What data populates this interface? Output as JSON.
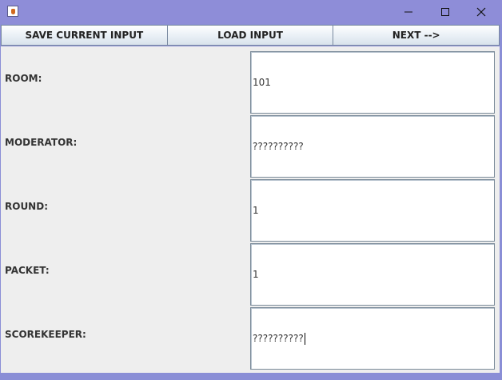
{
  "window": {
    "icon": "java-cup-icon",
    "controls": [
      "minimize-icon",
      "maximize-icon",
      "close-icon"
    ]
  },
  "toolbar": {
    "save_label": "SAVE CURRENT INPUT",
    "load_label": "LOAD INPUT",
    "next_label": "NEXT -->"
  },
  "form": {
    "rows": [
      {
        "label": "ROOM:",
        "value": "101"
      },
      {
        "label": "MODERATOR:",
        "value": "??????????"
      },
      {
        "label": "ROUND:",
        "value": "1"
      },
      {
        "label": "PACKET:",
        "value": "1"
      },
      {
        "label": "SCOREKEEPER:",
        "value": "??????????"
      }
    ]
  },
  "colors": {
    "titlebar": "#8e8dd8",
    "panel": "#eeeeee"
  }
}
